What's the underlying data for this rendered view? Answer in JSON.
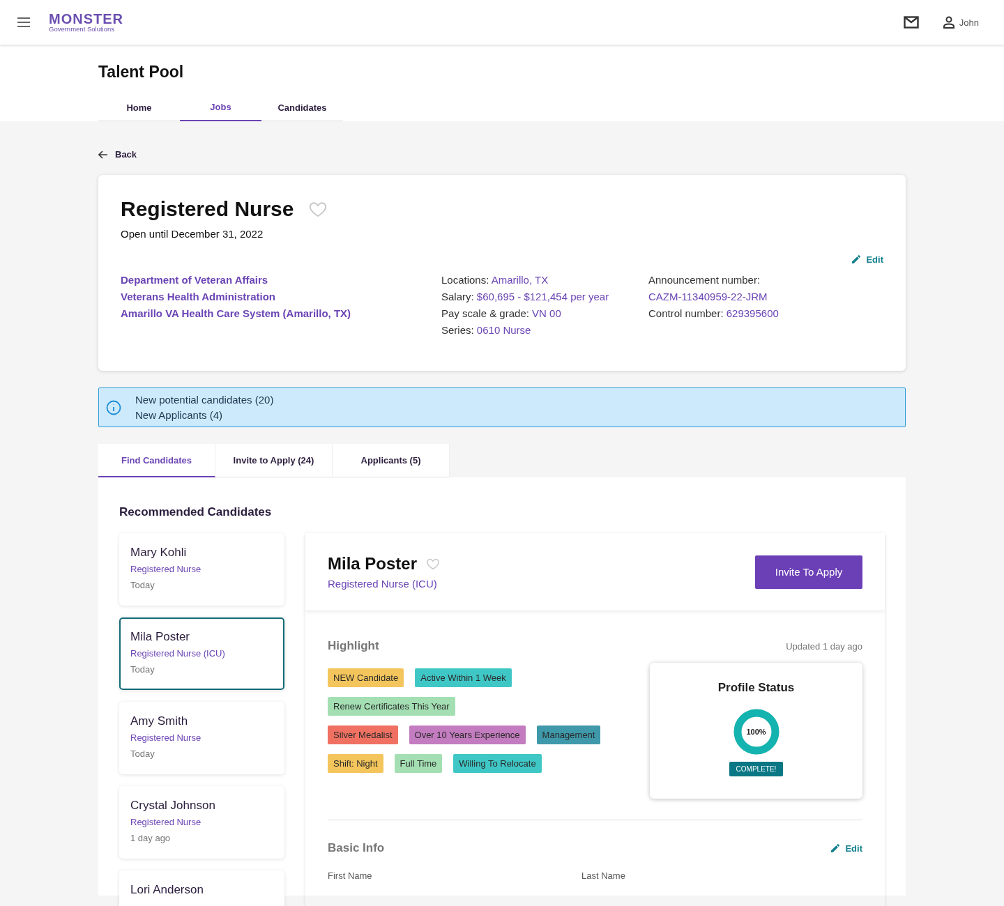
{
  "header": {
    "logo": {
      "title": "MONSTER",
      "subtitle": "Government Solutions"
    },
    "user": "John"
  },
  "page_title": "Talent Pool",
  "nav_tabs": [
    {
      "label": "Home",
      "selected": false
    },
    {
      "label": "Jobs",
      "selected": true
    },
    {
      "label": "Candidates",
      "selected": false
    }
  ],
  "back": "Back",
  "job": {
    "title": "Registered Nurse",
    "favorite": false,
    "open_until": "Open until December 31, 2022",
    "edit": "Edit",
    "organization": [
      "Department of Veteran Affairs",
      "Veterans Health Administration",
      "Amarillo VA Health Care System (Amarillo, TX)"
    ],
    "details": [
      {
        "label": "Locations:",
        "value": "Amarillo, TX"
      },
      {
        "label": "Salary:",
        "value": "$60,695 - $121,454 per year"
      },
      {
        "label": "Pay scale & grade:",
        "value": "VN 00"
      },
      {
        "label": "Series:",
        "value": "0610 Nurse"
      }
    ],
    "announcement_label": "Announcement number:",
    "announcement_number": "CAZM-11340959-22-JRM",
    "control": {
      "label": "Control number:",
      "value": "629395600"
    }
  },
  "notice": [
    "New potential candidates (20)",
    "New Applicants (4)"
  ],
  "candidate_tabs": [
    {
      "label": "Find Candidates",
      "selected": true
    },
    {
      "label": "Invite to Apply (24)",
      "selected": false
    },
    {
      "label": "Applicants (5)",
      "selected": false
    }
  ],
  "section_title": "Recommended Candidates",
  "candidates": [
    {
      "name": "Mary Kohli",
      "role": "Registered Nurse",
      "when": "Today",
      "selected": false
    },
    {
      "name": "Mila Poster",
      "role": "Registered Nurse (ICU)",
      "when": "Today",
      "selected": true
    },
    {
      "name": "Amy Smith",
      "role": "Registered Nurse",
      "when": "Today",
      "selected": false
    },
    {
      "name": "Crystal Johnson",
      "role": "Registered Nurse",
      "when": "1 day ago",
      "selected": false
    },
    {
      "name": "Lori Anderson",
      "selected": false
    }
  ],
  "profile": {
    "name": "Mila Poster",
    "favorite": false,
    "role": "Registered Nurse (ICU)",
    "action": "Invite To Apply",
    "highlight_title": "Highlight",
    "updated": "Updated 1 day ago",
    "tag_rows": [
      [
        {
          "label": "NEW Candidate",
          "color": "#f3c55c"
        },
        {
          "label": "Active Within 1 Week",
          "color": "#3fc7c6"
        }
      ],
      [
        {
          "label": "Renew Certificates This Year",
          "color": "#a3dfb3"
        }
      ],
      [
        {
          "label": "Silver Medalist",
          "color": "#f07162"
        },
        {
          "label": "Over 10 Years Experience",
          "color": "#c37cbf"
        },
        {
          "label": "Management",
          "color": "#3f99ab"
        }
      ],
      [
        {
          "label": "Shift: Night",
          "color": "#f3c55c"
        },
        {
          "label": "Full Time",
          "color": "#a3dfb3"
        },
        {
          "label": "Willing To Relocate",
          "color": "#3fc7c6"
        }
      ]
    ],
    "status": {
      "title": "Profile Status",
      "level": 1,
      "percent": "100%",
      "badge": "COMPLETE!"
    },
    "basic_info": {
      "title": "Basic Info",
      "edit": "Edit",
      "fields": [
        "First Name",
        "Last Name"
      ]
    }
  }
}
